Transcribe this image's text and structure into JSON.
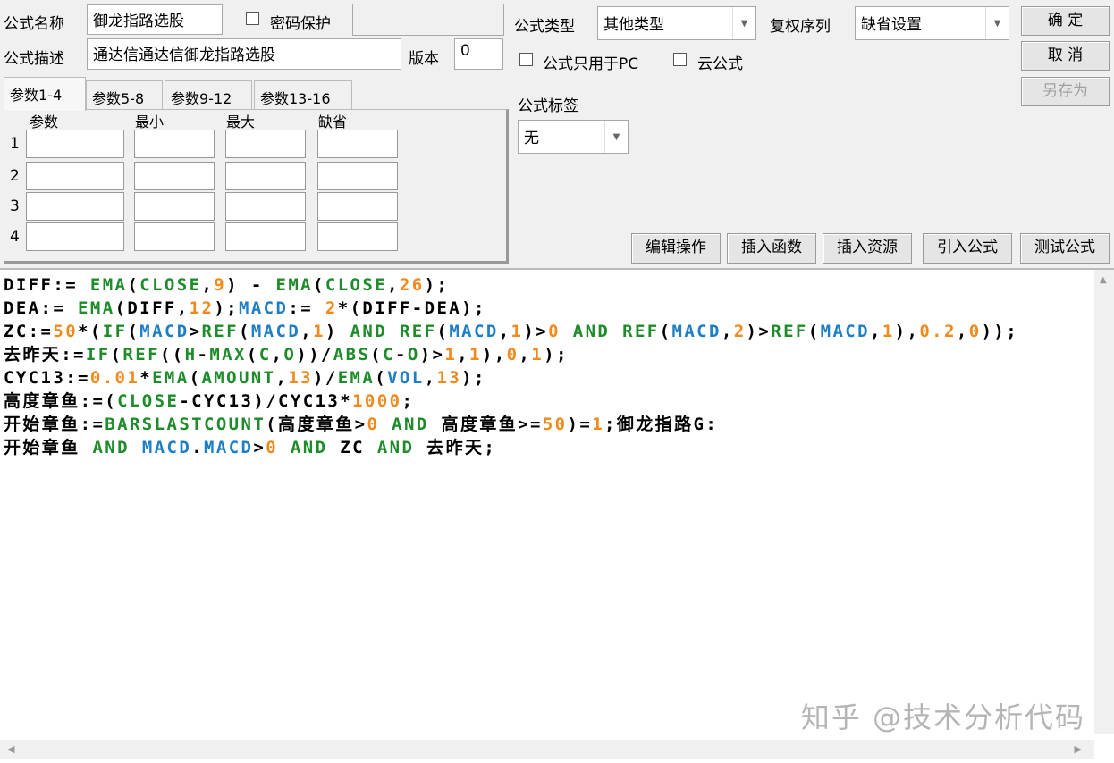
{
  "form": {
    "name_label": "公式名称",
    "name_value": "御龙指路选股",
    "password_label": "密码保护",
    "password_value": "",
    "desc_label": "公式描述",
    "desc_value": "通达信通达信御龙指路选股",
    "version_label": "版本",
    "version_value": "0",
    "type_label": "公式类型",
    "type_value": "其他类型",
    "rights_label": "复权序列",
    "rights_value": "缺省设置",
    "pc_only_label": "公式只用于PC",
    "cloud_label": "云公式",
    "tag_label": "公式标签",
    "tag_value": "无"
  },
  "buttons": {
    "ok": "确 定",
    "cancel": "取 消",
    "save_as": "另存为"
  },
  "tabs": [
    "参数1-4",
    "参数5-8",
    "参数9-12",
    "参数13-16"
  ],
  "params": {
    "headers": [
      "参数",
      "最小",
      "最大",
      "缺省"
    ],
    "rows": [
      "1",
      "2",
      "3",
      "4"
    ]
  },
  "toolbar": [
    "编辑操作",
    "插入函数",
    "插入资源",
    "引入公式",
    "测试公式"
  ],
  "code_lines": [
    [
      [
        "DIFF:= ",
        ""
      ],
      [
        "EMA",
        "k"
      ],
      [
        "(",
        ""
      ],
      [
        "CLOSE",
        "k"
      ],
      [
        ",",
        ""
      ],
      [
        "9",
        "n"
      ],
      [
        ") - ",
        ""
      ],
      [
        "EMA",
        "k"
      ],
      [
        "(",
        ""
      ],
      [
        "CLOSE",
        "k"
      ],
      [
        ",",
        ""
      ],
      [
        "26",
        "n"
      ],
      [
        ");",
        ""
      ]
    ],
    [
      [
        "DEA:= ",
        ""
      ],
      [
        "EMA",
        "k"
      ],
      [
        "(DIFF,",
        ""
      ],
      [
        "12",
        "n"
      ],
      [
        ");",
        ""
      ],
      [
        "MACD",
        "v"
      ],
      [
        ":= ",
        ""
      ],
      [
        "2",
        "n"
      ],
      [
        "*(DIFF-DEA);",
        ""
      ]
    ],
    [
      [
        "ZC:=",
        ""
      ],
      [
        "50",
        "n"
      ],
      [
        "*(",
        ""
      ],
      [
        "IF",
        "k"
      ],
      [
        "(",
        ""
      ],
      [
        "MACD",
        "v"
      ],
      [
        ">",
        ""
      ],
      [
        "REF",
        "k"
      ],
      [
        "(",
        ""
      ],
      [
        "MACD",
        "v"
      ],
      [
        ",",
        ""
      ],
      [
        "1",
        "n"
      ],
      [
        ") ",
        ""
      ],
      [
        "AND",
        "k"
      ],
      [
        " ",
        ""
      ],
      [
        "REF",
        "k"
      ],
      [
        "(",
        ""
      ],
      [
        "MACD",
        "v"
      ],
      [
        ",",
        ""
      ],
      [
        "1",
        "n"
      ],
      [
        ")>",
        ""
      ],
      [
        "0",
        "n"
      ],
      [
        " ",
        ""
      ],
      [
        "AND",
        "k"
      ],
      [
        " ",
        ""
      ],
      [
        "REF",
        "k"
      ],
      [
        "(",
        ""
      ],
      [
        "MACD",
        "v"
      ],
      [
        ",",
        ""
      ],
      [
        "2",
        "n"
      ],
      [
        ")>",
        ""
      ],
      [
        "REF",
        "k"
      ],
      [
        "(",
        ""
      ],
      [
        "MACD",
        "v"
      ],
      [
        ",",
        ""
      ],
      [
        "1",
        "n"
      ],
      [
        "),",
        ""
      ],
      [
        "0.2",
        "n"
      ],
      [
        ",",
        ""
      ],
      [
        "0",
        "n"
      ],
      [
        "));",
        ""
      ]
    ],
    [
      [
        "去昨天:=",
        ""
      ],
      [
        "IF",
        "k"
      ],
      [
        "(",
        ""
      ],
      [
        "REF",
        "k"
      ],
      [
        "((",
        ""
      ],
      [
        "H",
        "k"
      ],
      [
        "-",
        ""
      ],
      [
        "MAX",
        "k"
      ],
      [
        "(",
        ""
      ],
      [
        "C",
        "k"
      ],
      [
        ",",
        ""
      ],
      [
        "O",
        "k"
      ],
      [
        "))/",
        ""
      ],
      [
        "ABS",
        "k"
      ],
      [
        "(",
        ""
      ],
      [
        "C",
        "k"
      ],
      [
        "-",
        ""
      ],
      [
        "O",
        "k"
      ],
      [
        ")>",
        ""
      ],
      [
        "1",
        "n"
      ],
      [
        ",",
        ""
      ],
      [
        "1",
        "n"
      ],
      [
        "),",
        ""
      ],
      [
        "0",
        "n"
      ],
      [
        ",",
        ""
      ],
      [
        "1",
        "n"
      ],
      [
        ");",
        ""
      ]
    ],
    [
      [
        "CYC13:=",
        ""
      ],
      [
        "0.01",
        "n"
      ],
      [
        "*",
        ""
      ],
      [
        "EMA",
        "k"
      ],
      [
        "(",
        ""
      ],
      [
        "AMOUNT",
        "k"
      ],
      [
        ",",
        ""
      ],
      [
        "13",
        "n"
      ],
      [
        ")/",
        ""
      ],
      [
        "EMA",
        "k"
      ],
      [
        "(",
        ""
      ],
      [
        "VOL",
        "v"
      ],
      [
        ",",
        ""
      ],
      [
        "13",
        "n"
      ],
      [
        ");",
        ""
      ]
    ],
    [
      [
        "高度章鱼:=(",
        ""
      ],
      [
        "CLOSE",
        "k"
      ],
      [
        "-CYC13)/CYC13*",
        ""
      ],
      [
        "1000",
        "n"
      ],
      [
        ";",
        ""
      ]
    ],
    [
      [
        "开始章鱼:=",
        ""
      ],
      [
        "BARSLASTCOUNT",
        "k"
      ],
      [
        "(高度章鱼>",
        ""
      ],
      [
        "0",
        "n"
      ],
      [
        " ",
        ""
      ],
      [
        "AND",
        "k"
      ],
      [
        " 高度章鱼>=",
        ""
      ],
      [
        "50",
        "n"
      ],
      [
        ")=",
        ""
      ],
      [
        "1",
        "n"
      ],
      [
        ";御龙指路G:",
        ""
      ]
    ],
    [
      [
        "开始章鱼 ",
        ""
      ],
      [
        "AND",
        "k"
      ],
      [
        " ",
        ""
      ],
      [
        "MACD",
        "v"
      ],
      [
        ".",
        ""
      ],
      [
        "MACD",
        "v"
      ],
      [
        ">",
        ""
      ],
      [
        "0",
        "n"
      ],
      [
        " ",
        ""
      ],
      [
        "AND",
        "k"
      ],
      [
        " ZC ",
        ""
      ],
      [
        "AND",
        "k"
      ],
      [
        " 去昨天;",
        ""
      ]
    ]
  ],
  "watermark": "知乎 @技术分析代码"
}
